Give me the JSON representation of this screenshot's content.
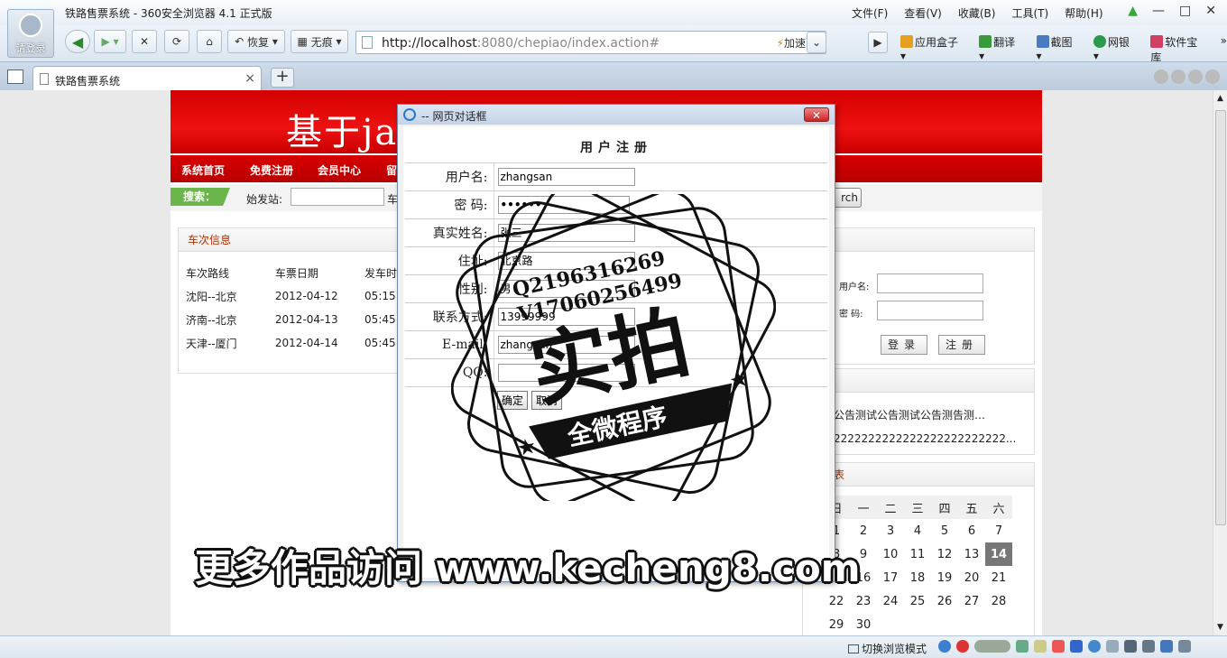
{
  "browser": {
    "window_title": "铁路售票系统 - 360安全浏览器 4.1 正式版",
    "login_label": "请登录",
    "menu": [
      "文件(F)",
      "查看(V)",
      "收藏(B)",
      "工具(T)",
      "帮助(H)"
    ],
    "restore_label": "恢复",
    "incognito_label": "无痕",
    "url_host": "http://localhost",
    "url_rest": ":8080/chepiao/index.action#",
    "accelerate_label": "加速",
    "tools": [
      "应用盒子",
      "翻译",
      "截图",
      "网银",
      "软件宝库"
    ],
    "tab_title": "铁路售票系统",
    "status_mode": "切换浏览模式"
  },
  "site": {
    "banner_title": "基于ja                    与实现",
    "nav": [
      "系统首页",
      "免费注册",
      "会员中心",
      "留"
    ],
    "search_label": "搜索：",
    "from_label": "始发站:",
    "to_label": "车",
    "search_button": "rch",
    "trains": {
      "title": "车次信息",
      "headers": [
        "车次路线",
        "车票日期",
        "发车时"
      ],
      "rows": [
        [
          "沈阳--北京",
          "2012-04-12",
          "05:15"
        ],
        [
          "济南--北京",
          "2012-04-13",
          "05:45"
        ],
        [
          "天津--厦门",
          "2012-04-14",
          "05:45"
        ]
      ]
    },
    "login": {
      "title": "登录",
      "username_label": "用户名:",
      "password_label": "密   码:",
      "login_button": "登录",
      "register_button": "注册"
    },
    "notice": {
      "title": "公告",
      "line1": "公告测试公告测试公告测告测…",
      "line2": "2222222222222222222222222..."
    },
    "calendar": {
      "title": "日历表",
      "weekdays": [
        "日",
        "一",
        "二",
        "三",
        "四",
        "五",
        "六"
      ],
      "weeks": [
        [
          "1",
          "2",
          "3",
          "4",
          "5",
          "6",
          "7"
        ],
        [
          "8",
          "9",
          "10",
          "11",
          "12",
          "13",
          "14"
        ],
        [
          "15",
          "16",
          "17",
          "18",
          "19",
          "20",
          "21"
        ],
        [
          "22",
          "23",
          "24",
          "25",
          "26",
          "27",
          "28"
        ],
        [
          "29",
          "30",
          "",
          "",
          "",
          "",
          ""
        ]
      ],
      "today": "14"
    }
  },
  "dialog": {
    "title": "-- 网页对话框",
    "form_title": "用户注册",
    "fields": [
      {
        "label": "用户名:",
        "value": "zhangsan"
      },
      {
        "label": "密  码:",
        "value": "••••••"
      },
      {
        "label": "真实姓名:",
        "value": "张三"
      },
      {
        "label": "住址:",
        "value": "北京路"
      },
      {
        "label": "性别:",
        "value": "男"
      },
      {
        "label": "联系方式:",
        "value": "13999999"
      },
      {
        "label": "E-mail:",
        "value": "zhangsan"
      },
      {
        "label": "QQ:",
        "value": ""
      }
    ],
    "confirm_button": "确定",
    "cancel_button": "取消"
  },
  "watermark": {
    "stamp_line1": "Q2196316269",
    "stamp_line2": "V17060256499",
    "stamp_big": "实拍",
    "stamp_ribbon": "全微程序",
    "footer_text": "更多作品访问 www.kecheng8.com"
  },
  "colors": {
    "banner_red": "#e00000",
    "search_green": "#6bb64a",
    "panel_title": "#b03000"
  }
}
